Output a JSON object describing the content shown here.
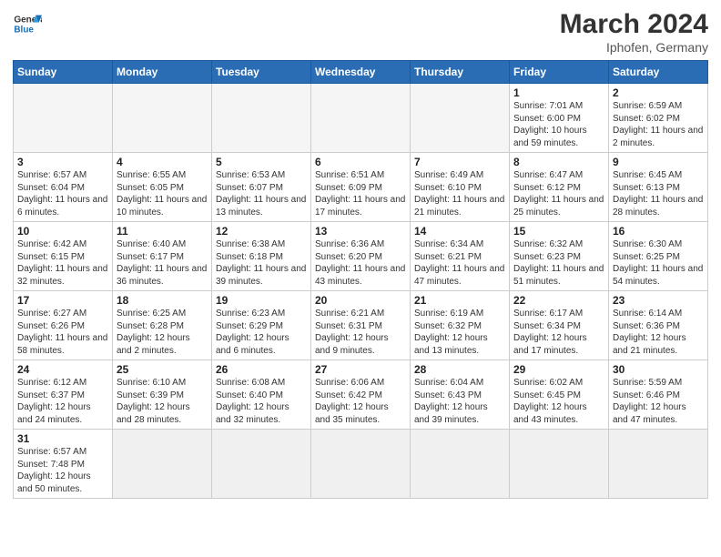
{
  "header": {
    "logo_general": "General",
    "logo_blue": "Blue",
    "month_year": "March 2024",
    "location": "Iphofen, Germany"
  },
  "days_of_week": [
    "Sunday",
    "Monday",
    "Tuesday",
    "Wednesday",
    "Thursday",
    "Friday",
    "Saturday"
  ],
  "weeks": [
    [
      {
        "day": "",
        "info": "",
        "empty": true
      },
      {
        "day": "",
        "info": "",
        "empty": true
      },
      {
        "day": "",
        "info": "",
        "empty": true
      },
      {
        "day": "",
        "info": "",
        "empty": true
      },
      {
        "day": "",
        "info": "",
        "empty": true
      },
      {
        "day": "1",
        "info": "Sunrise: 7:01 AM\nSunset: 6:00 PM\nDaylight: 10 hours and 59 minutes."
      },
      {
        "day": "2",
        "info": "Sunrise: 6:59 AM\nSunset: 6:02 PM\nDaylight: 11 hours and 2 minutes."
      }
    ],
    [
      {
        "day": "3",
        "info": "Sunrise: 6:57 AM\nSunset: 6:04 PM\nDaylight: 11 hours and 6 minutes."
      },
      {
        "day": "4",
        "info": "Sunrise: 6:55 AM\nSunset: 6:05 PM\nDaylight: 11 hours and 10 minutes."
      },
      {
        "day": "5",
        "info": "Sunrise: 6:53 AM\nSunset: 6:07 PM\nDaylight: 11 hours and 13 minutes."
      },
      {
        "day": "6",
        "info": "Sunrise: 6:51 AM\nSunset: 6:09 PM\nDaylight: 11 hours and 17 minutes."
      },
      {
        "day": "7",
        "info": "Sunrise: 6:49 AM\nSunset: 6:10 PM\nDaylight: 11 hours and 21 minutes."
      },
      {
        "day": "8",
        "info": "Sunrise: 6:47 AM\nSunset: 6:12 PM\nDaylight: 11 hours and 25 minutes."
      },
      {
        "day": "9",
        "info": "Sunrise: 6:45 AM\nSunset: 6:13 PM\nDaylight: 11 hours and 28 minutes."
      }
    ],
    [
      {
        "day": "10",
        "info": "Sunrise: 6:42 AM\nSunset: 6:15 PM\nDaylight: 11 hours and 32 minutes."
      },
      {
        "day": "11",
        "info": "Sunrise: 6:40 AM\nSunset: 6:17 PM\nDaylight: 11 hours and 36 minutes."
      },
      {
        "day": "12",
        "info": "Sunrise: 6:38 AM\nSunset: 6:18 PM\nDaylight: 11 hours and 39 minutes."
      },
      {
        "day": "13",
        "info": "Sunrise: 6:36 AM\nSunset: 6:20 PM\nDaylight: 11 hours and 43 minutes."
      },
      {
        "day": "14",
        "info": "Sunrise: 6:34 AM\nSunset: 6:21 PM\nDaylight: 11 hours and 47 minutes."
      },
      {
        "day": "15",
        "info": "Sunrise: 6:32 AM\nSunset: 6:23 PM\nDaylight: 11 hours and 51 minutes."
      },
      {
        "day": "16",
        "info": "Sunrise: 6:30 AM\nSunset: 6:25 PM\nDaylight: 11 hours and 54 minutes."
      }
    ],
    [
      {
        "day": "17",
        "info": "Sunrise: 6:27 AM\nSunset: 6:26 PM\nDaylight: 11 hours and 58 minutes."
      },
      {
        "day": "18",
        "info": "Sunrise: 6:25 AM\nSunset: 6:28 PM\nDaylight: 12 hours and 2 minutes."
      },
      {
        "day": "19",
        "info": "Sunrise: 6:23 AM\nSunset: 6:29 PM\nDaylight: 12 hours and 6 minutes."
      },
      {
        "day": "20",
        "info": "Sunrise: 6:21 AM\nSunset: 6:31 PM\nDaylight: 12 hours and 9 minutes."
      },
      {
        "day": "21",
        "info": "Sunrise: 6:19 AM\nSunset: 6:32 PM\nDaylight: 12 hours and 13 minutes."
      },
      {
        "day": "22",
        "info": "Sunrise: 6:17 AM\nSunset: 6:34 PM\nDaylight: 12 hours and 17 minutes."
      },
      {
        "day": "23",
        "info": "Sunrise: 6:14 AM\nSunset: 6:36 PM\nDaylight: 12 hours and 21 minutes."
      }
    ],
    [
      {
        "day": "24",
        "info": "Sunrise: 6:12 AM\nSunset: 6:37 PM\nDaylight: 12 hours and 24 minutes."
      },
      {
        "day": "25",
        "info": "Sunrise: 6:10 AM\nSunset: 6:39 PM\nDaylight: 12 hours and 28 minutes."
      },
      {
        "day": "26",
        "info": "Sunrise: 6:08 AM\nSunset: 6:40 PM\nDaylight: 12 hours and 32 minutes."
      },
      {
        "day": "27",
        "info": "Sunrise: 6:06 AM\nSunset: 6:42 PM\nDaylight: 12 hours and 35 minutes."
      },
      {
        "day": "28",
        "info": "Sunrise: 6:04 AM\nSunset: 6:43 PM\nDaylight: 12 hours and 39 minutes."
      },
      {
        "day": "29",
        "info": "Sunrise: 6:02 AM\nSunset: 6:45 PM\nDaylight: 12 hours and 43 minutes."
      },
      {
        "day": "30",
        "info": "Sunrise: 5:59 AM\nSunset: 6:46 PM\nDaylight: 12 hours and 47 minutes."
      }
    ],
    [
      {
        "day": "31",
        "info": "Sunrise: 6:57 AM\nSunset: 7:48 PM\nDaylight: 12 hours and 50 minutes."
      },
      {
        "day": "",
        "info": "",
        "empty": true
      },
      {
        "day": "",
        "info": "",
        "empty": true
      },
      {
        "day": "",
        "info": "",
        "empty": true
      },
      {
        "day": "",
        "info": "",
        "empty": true
      },
      {
        "day": "",
        "info": "",
        "empty": true
      },
      {
        "day": "",
        "info": "",
        "empty": true
      }
    ]
  ]
}
